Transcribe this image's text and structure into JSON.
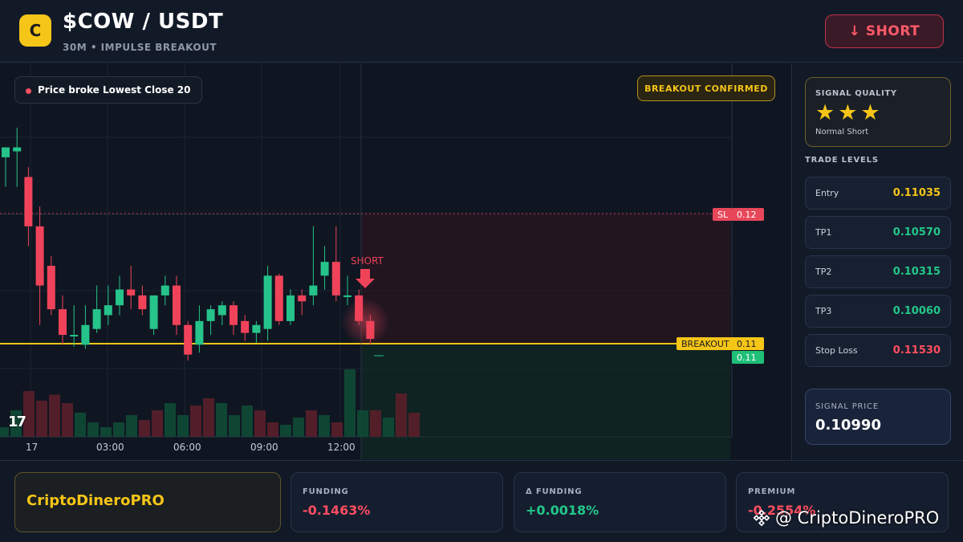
{
  "header": {
    "logo_letter": "C",
    "title": "$COW / USDT",
    "subtitle": "30M • IMPULSE BREAKOUT",
    "action_label": "↓ SHORT"
  },
  "chart_overlay": {
    "signal_pill": "Price broke Lowest Close 20",
    "status_badge": "BREAKOUT CONFIRMED",
    "sl_tag": "SL",
    "sl_value": "0.12",
    "breakout_tag": "BREAKOUT",
    "breakout_value": "0.11",
    "current_value": "0.11",
    "short_marker": "SHORT",
    "platform_logo": "17"
  },
  "chart_data": {
    "type": "candlestick",
    "x_ticks": [
      "17",
      "03:00",
      "06:00",
      "09:00",
      "12:00"
    ],
    "sl_level": 0.1153,
    "breakout_level": 0.1099,
    "candles": [
      {
        "o": 0.1185,
        "h": 0.119,
        "l": 0.117,
        "c": 0.119
      },
      {
        "o": 0.1188,
        "h": 0.12,
        "l": 0.117,
        "c": 0.119
      },
      {
        "o": 0.1175,
        "h": 0.118,
        "l": 0.114,
        "c": 0.115
      },
      {
        "o": 0.115,
        "h": 0.116,
        "l": 0.11,
        "c": 0.112
      },
      {
        "o": 0.113,
        "h": 0.1135,
        "l": 0.1105,
        "c": 0.1108
      },
      {
        "o": 0.1108,
        "h": 0.1115,
        "l": 0.109,
        "c": 0.1095
      },
      {
        "o": 0.1095,
        "h": 0.111,
        "l": 0.1089,
        "c": 0.1095
      },
      {
        "o": 0.109,
        "h": 0.111,
        "l": 0.1088,
        "c": 0.11
      },
      {
        "o": 0.1098,
        "h": 0.112,
        "l": 0.1096,
        "c": 0.1108
      },
      {
        "o": 0.1105,
        "h": 0.112,
        "l": 0.11,
        "c": 0.111
      },
      {
        "o": 0.111,
        "h": 0.1125,
        "l": 0.1105,
        "c": 0.1118
      },
      {
        "o": 0.1118,
        "h": 0.113,
        "l": 0.1108,
        "c": 0.1115
      },
      {
        "o": 0.1115,
        "h": 0.112,
        "l": 0.1105,
        "c": 0.1108
      },
      {
        "o": 0.1098,
        "h": 0.1115,
        "l": 0.1095,
        "c": 0.1115
      },
      {
        "o": 0.1115,
        "h": 0.1125,
        "l": 0.111,
        "c": 0.112
      },
      {
        "o": 0.112,
        "h": 0.1125,
        "l": 0.1095,
        "c": 0.11
      },
      {
        "o": 0.11,
        "h": 0.1102,
        "l": 0.1082,
        "c": 0.1085
      },
      {
        "o": 0.109,
        "h": 0.111,
        "l": 0.1086,
        "c": 0.1102
      },
      {
        "o": 0.1102,
        "h": 0.111,
        "l": 0.1095,
        "c": 0.1108
      },
      {
        "o": 0.1105,
        "h": 0.1112,
        "l": 0.11,
        "c": 0.111
      },
      {
        "o": 0.111,
        "h": 0.1112,
        "l": 0.1095,
        "c": 0.11
      },
      {
        "o": 0.1102,
        "h": 0.1105,
        "l": 0.1092,
        "c": 0.1096
      },
      {
        "o": 0.1096,
        "h": 0.1102,
        "l": 0.1091,
        "c": 0.11
      },
      {
        "o": 0.1098,
        "h": 0.113,
        "l": 0.1092,
        "c": 0.1125
      },
      {
        "o": 0.1125,
        "h": 0.1126,
        "l": 0.11,
        "c": 0.1102
      },
      {
        "o": 0.1102,
        "h": 0.1118,
        "l": 0.11,
        "c": 0.1115
      },
      {
        "o": 0.1115,
        "h": 0.1118,
        "l": 0.1105,
        "c": 0.1112
      },
      {
        "o": 0.1115,
        "h": 0.115,
        "l": 0.111,
        "c": 0.112
      },
      {
        "o": 0.1125,
        "h": 0.114,
        "l": 0.1118,
        "c": 0.1132
      },
      {
        "o": 0.1132,
        "h": 0.115,
        "l": 0.1112,
        "c": 0.1115
      },
      {
        "o": 0.1115,
        "h": 0.1125,
        "l": 0.111,
        "c": 0.1115
      },
      {
        "o": 0.1115,
        "h": 0.1118,
        "l": 0.11,
        "c": 0.1102
      },
      {
        "o": 0.1102,
        "h": 0.1105,
        "l": 0.109,
        "c": 0.1093
      }
    ],
    "volumes": [
      8,
      22,
      38,
      30,
      35,
      28,
      20,
      12,
      8,
      12,
      18,
      14,
      22,
      28,
      18,
      26,
      32,
      28,
      18,
      26,
      22,
      12,
      10,
      16,
      22,
      18,
      12,
      56,
      22,
      22,
      16,
      36,
      20
    ]
  },
  "panel": {
    "quality_label": "SIGNAL QUALITY",
    "stars": "★★★",
    "quality_type": "Normal Short",
    "levels_title": "TRADE LEVELS",
    "levels": [
      {
        "name": "Entry",
        "value": "0.11035",
        "color": "#f5c518"
      },
      {
        "name": "TP1",
        "value": "0.10570",
        "color": "#22c78a"
      },
      {
        "name": "TP2",
        "value": "0.10315",
        "color": "#22c78a"
      },
      {
        "name": "TP3",
        "value": "0.10060",
        "color": "#22c78a"
      },
      {
        "name": "Stop Loss",
        "value": "0.11530",
        "color": "#ff4d61"
      }
    ],
    "signal_price_label": "SIGNAL PRICE",
    "signal_price": "0.10990"
  },
  "footer": {
    "brand": "CriptoDineroPRO",
    "stats": [
      {
        "label": "FUNDING",
        "value": "-0.1463%",
        "color": "#ff4d61"
      },
      {
        "label": "Δ FUNDING",
        "value": "+0.0018%",
        "color": "#22c78a"
      },
      {
        "label": "PREMIUM",
        "value": "-0.2554%",
        "color": "#ff4d61"
      }
    ],
    "watermark": "@ CriptoDineroPRO"
  },
  "colors": {
    "up": "#26c38a",
    "down": "#f0435a",
    "accent": "#f5c518"
  }
}
